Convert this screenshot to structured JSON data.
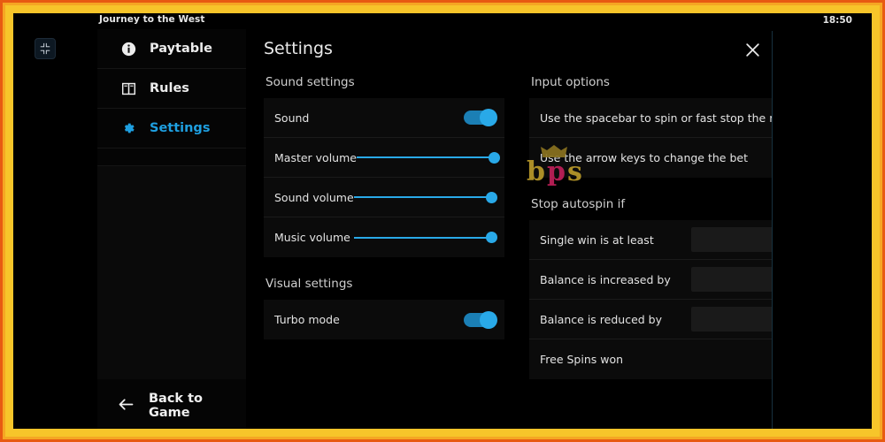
{
  "window": {
    "game_title": "Journey to the West",
    "clock": "18:50",
    "fullscreen_icon": "exit-fullscreen-icon"
  },
  "sidebar": {
    "items": [
      {
        "label": "Paytable",
        "icon": "info-icon",
        "active": false
      },
      {
        "label": "Rules",
        "icon": "book-icon",
        "active": false
      },
      {
        "label": "Settings",
        "icon": "gear-icon",
        "active": true
      }
    ],
    "back_label": "Back to Game",
    "back_icon": "arrow-left-icon"
  },
  "panel": {
    "title": "Settings",
    "close_icon": "close-icon",
    "sections": {
      "sound": {
        "title": "Sound settings",
        "rows": [
          {
            "label": "Sound",
            "type": "toggle",
            "state": "on"
          },
          {
            "label": "Master volume",
            "type": "slider",
            "value": 100
          },
          {
            "label": "Sound volume",
            "type": "slider",
            "value": 100
          },
          {
            "label": "Music volume",
            "type": "slider",
            "value": 100
          }
        ]
      },
      "visual": {
        "title": "Visual settings",
        "rows": [
          {
            "label": "Turbo mode",
            "type": "toggle",
            "state": "on"
          }
        ]
      },
      "input": {
        "title": "Input options",
        "rows": [
          {
            "label": "Use the spacebar to spin or fast stop the reels",
            "type": "toggle",
            "state": "on"
          },
          {
            "label": "Use the arrow keys to change the bet",
            "type": "toggle",
            "state": "on"
          }
        ]
      },
      "autospin": {
        "title": "Stop autospin if",
        "rows": [
          {
            "label": "Single win is at least",
            "type": "input-toggle",
            "value": "",
            "state": "off"
          },
          {
            "label": "Balance is increased by",
            "type": "input-toggle",
            "value": "",
            "state": "off"
          },
          {
            "label": "Balance is reduced by",
            "type": "input-toggle",
            "value": "",
            "state": "off"
          },
          {
            "label": "Free Spins won",
            "type": "toggle",
            "state": "on"
          }
        ]
      }
    }
  },
  "watermark": {
    "text_b": "b",
    "text_p": "p",
    "text_s": "s"
  },
  "colors": {
    "accent": "#29a9e8",
    "accent_track": "#1b7fb5",
    "off_track": "#3a3a3a",
    "off_knob": "#b9b9b9",
    "frame_outer": "#e85a12",
    "frame_mid": "#f5a623",
    "frame_inner": "#f7c52a",
    "background": "#000000"
  }
}
